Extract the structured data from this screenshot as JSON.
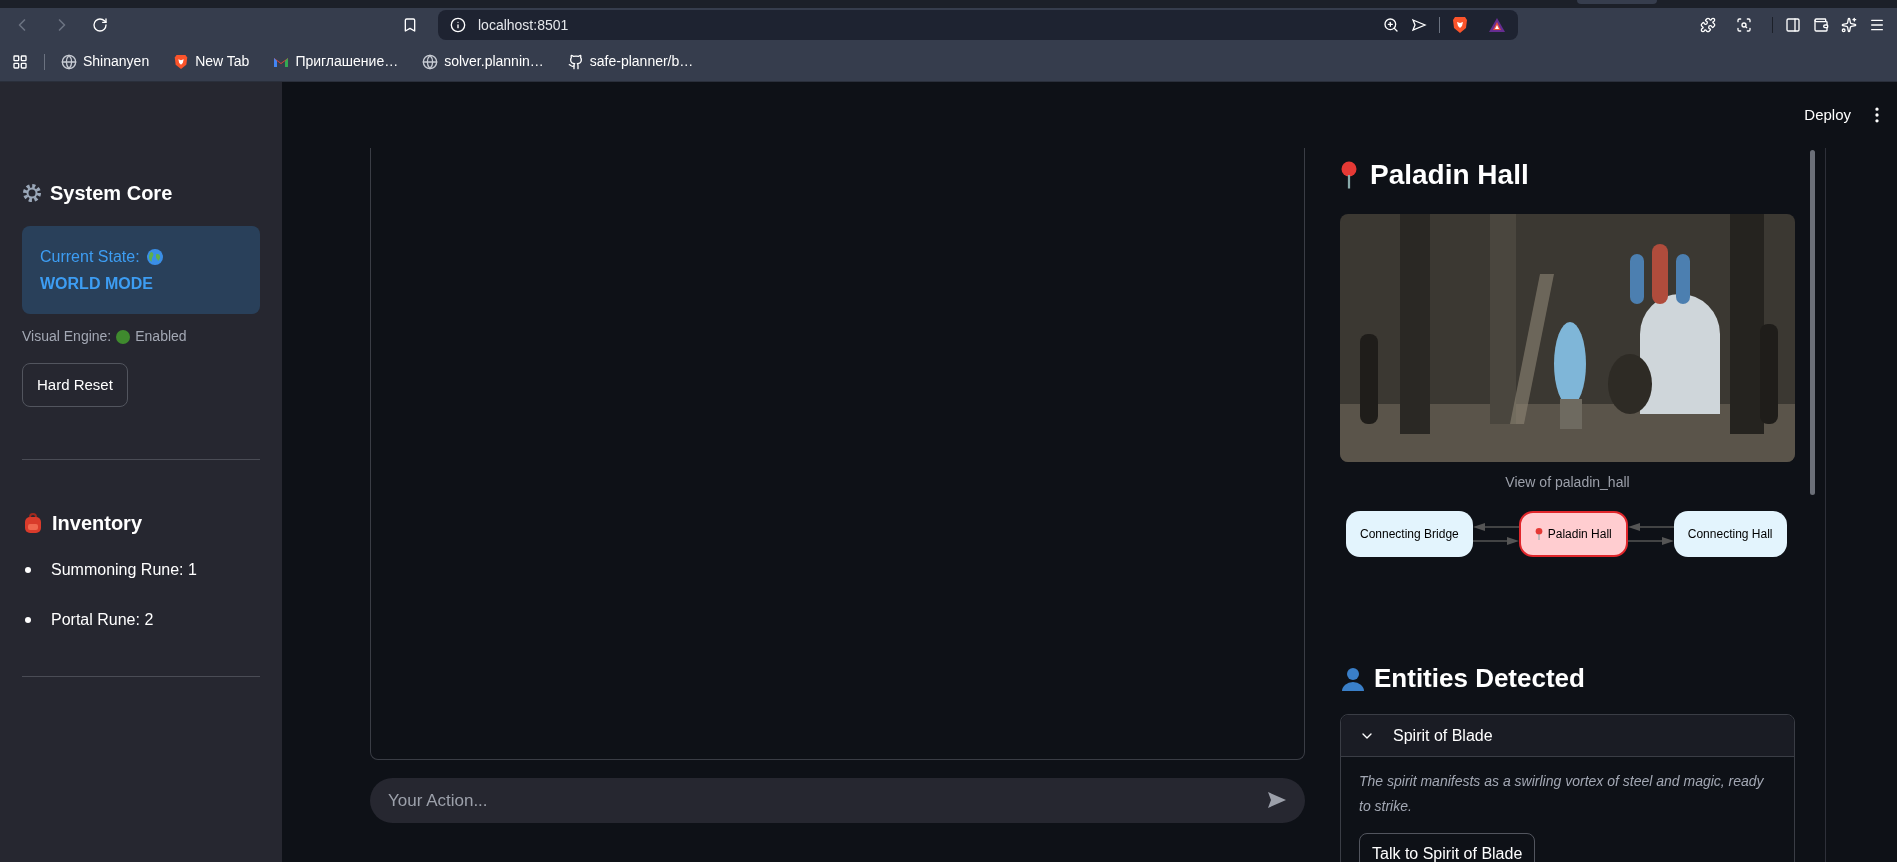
{
  "browser": {
    "url": "localhost:8501",
    "bookmarks": [
      {
        "label": "Shinanyen",
        "kind": "site"
      },
      {
        "label": "New Tab",
        "kind": "brave"
      },
      {
        "label": "Приглашение…",
        "kind": "mail"
      },
      {
        "label": "solver.plannin…",
        "kind": "site"
      },
      {
        "label": "safe-planner/b…",
        "kind": "github"
      }
    ]
  },
  "app_header": {
    "deploy": "Deploy"
  },
  "sidebar": {
    "system_title": "System Core",
    "state_label": "Current State:",
    "state_value": "WORLD MODE",
    "engine_label": "Visual Engine:",
    "engine_status": "Enabled",
    "engine_on": true,
    "reset_button": "Hard Reset",
    "inventory_title": "Inventory",
    "inventory": [
      "Summoning Rune: 1",
      "Portal Rune: 2"
    ]
  },
  "chat_input": {
    "placeholder": "Your Action..."
  },
  "location": {
    "title": "Paladin Hall",
    "caption": "View of paladin_hall",
    "map_nodes": [
      {
        "label": "Connecting Bridge",
        "current": false
      },
      {
        "label": "Paladin Hall",
        "current": true
      },
      {
        "label": "Connecting Hall",
        "current": false
      }
    ]
  },
  "entities": {
    "title": "Entities Detected",
    "items": [
      {
        "name": "Spirit of Blade",
        "expanded": true,
        "description": "The spirit manifests as a swirling vortex of steel and magic, ready to strike.",
        "action": "Talk to Spirit of Blade"
      }
    ]
  }
}
